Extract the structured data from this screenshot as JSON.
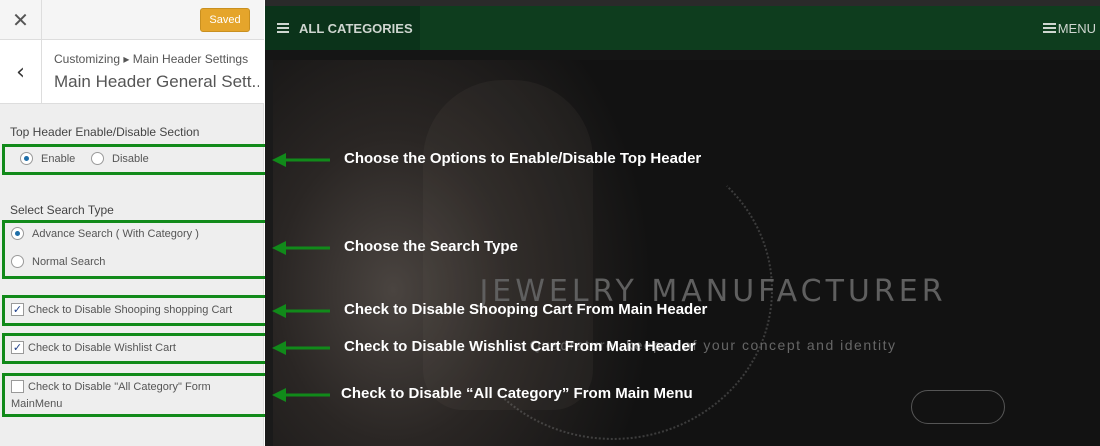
{
  "sidebar": {
    "close_icon": "close-icon",
    "saved_label": "Saved",
    "back_icon": "chevron-left-icon",
    "breadcrumb": "Customizing ▸ Main Header Settings",
    "panel_title": "Main Header General Settings",
    "top_header_section": {
      "label": "Top Header Enable/Disable Section",
      "options": [
        "Enable",
        "Disable"
      ],
      "selected": "Enable"
    },
    "search_section": {
      "label": "Select Search Type",
      "options": [
        "Advance Search ( With Category )",
        "Normal Search"
      ],
      "selected": "Advance Search ( With Category )"
    },
    "checkboxes": [
      {
        "label": "Check to Disable Shooping shopping Cart",
        "checked": true
      },
      {
        "label": "Check to Disable Wishlist Cart",
        "checked": true
      },
      {
        "label_line1": "Check to Disable \"All Category\" Form",
        "label_line2": "MainMenu",
        "checked": false
      }
    ]
  },
  "preview": {
    "nav": {
      "all_categories": "ALL CATEGORIES",
      "menu": "MENU"
    },
    "hero": {
      "title": "JEWELRY MANUFACTURER",
      "subtitle": "Quadrature, keeper of your concept and identity"
    }
  },
  "annotations": [
    "Choose the Options to Enable/Disable Top Header",
    "Choose the Search Type",
    "Check to Disable Shooping Cart From Main Header",
    "Check to Disable Wishlist Cart From Main Header",
    "Check to Disable “All Category” From Main Menu"
  ],
  "colors": {
    "annotation_green": "#118a1a",
    "saved_button": "#e5a52b",
    "nav_green": "#0e3d1e"
  }
}
